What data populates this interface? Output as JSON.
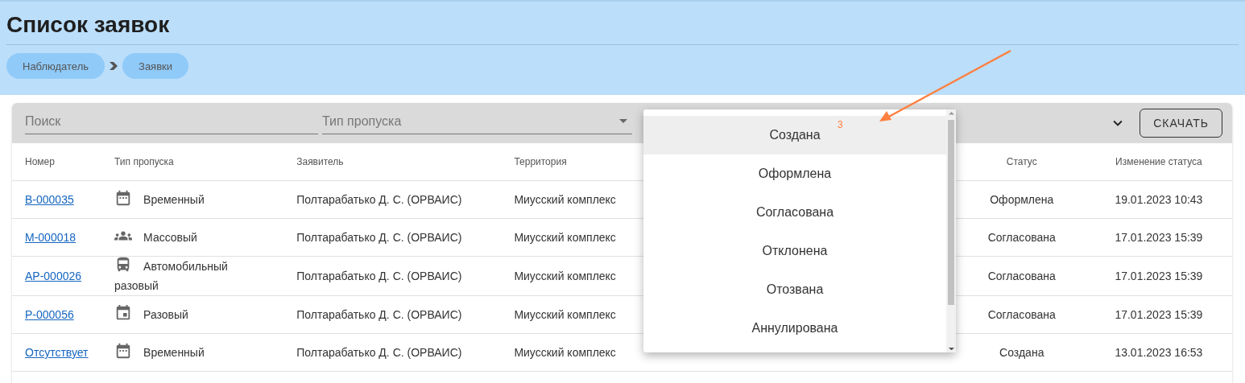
{
  "page_title": "Список заявок",
  "breadcrumbs": [
    "Наблюдатель",
    "Заявки"
  ],
  "filters": {
    "search": {
      "placeholder": "Поиск"
    },
    "pass_type": {
      "placeholder": "Тип пропуска"
    },
    "download_button": "СКАЧАТЬ"
  },
  "table": {
    "columns": [
      "Номер",
      "Тип пропуска",
      "Заявитель",
      "Территория",
      "Статус",
      "Изменение статуса"
    ],
    "rows": [
      {
        "number": "В-000035",
        "type": "Временный",
        "kind": "calendar",
        "applicant": "Полтарабатько Д. С. (ОРВАИС)",
        "territory": "Миусский комплекс",
        "status": "Оформлена",
        "changed": "19.01.2023 10:43"
      },
      {
        "number": "М-000018",
        "type": "Массовый",
        "kind": "group",
        "applicant": "Полтарабатько Д. С. (ОРВАИС)",
        "territory": "Миусский комплекс",
        "status": "Согласована",
        "changed": "17.01.2023 15:39"
      },
      {
        "number": "АР-000026",
        "type": "Автомобильный разовый",
        "kind": "bus",
        "applicant": "Полтарабатько Д. С. (ОРВАИС)",
        "territory": "Миусский комплекс",
        "status": "Согласована",
        "changed": "17.01.2023 15:39"
      },
      {
        "number": "Р-000056",
        "type": "Разовый",
        "kind": "event",
        "applicant": "Полтарабатько Д. С. (ОРВАИС)",
        "territory": "Миусский комплекс",
        "status": "Согласована",
        "changed": "17.01.2023 15:39"
      },
      {
        "number": "Отсутствует",
        "type": "Временный",
        "kind": "calendar",
        "applicant": "Полтарабатько Д. С. (ОРВАИС)",
        "territory": "Миусский комплекс",
        "status": "Создана",
        "changed": "13.01.2023 16:53"
      }
    ]
  },
  "status_dropdown": {
    "options": [
      {
        "label": "Создана",
        "selected": true
      },
      {
        "label": "Оформлена",
        "selected": false
      },
      {
        "label": "Согласована",
        "selected": false
      },
      {
        "label": "Отклонена",
        "selected": false
      },
      {
        "label": "Отозвана",
        "selected": false
      },
      {
        "label": "Аннулирована",
        "selected": false
      }
    ]
  },
  "annotation": {
    "label": "3"
  }
}
